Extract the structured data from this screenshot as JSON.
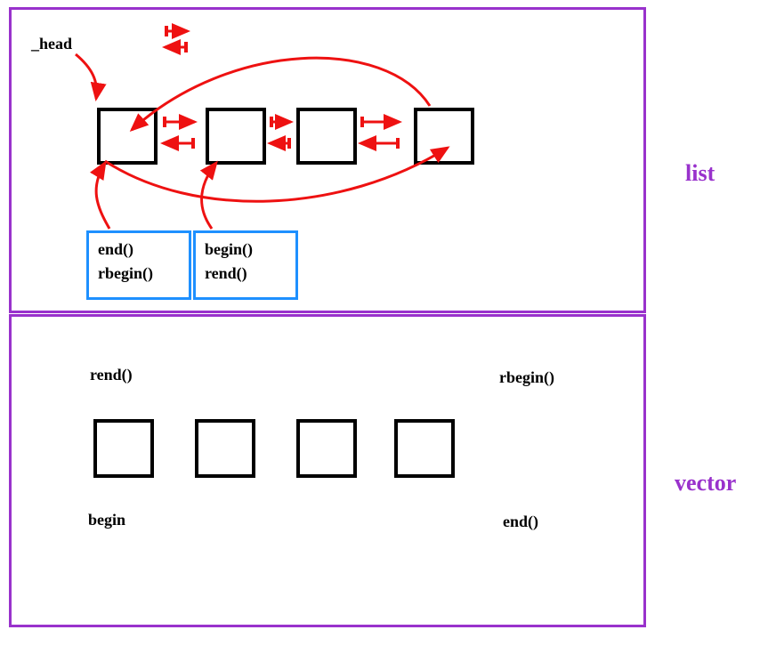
{
  "labels": {
    "list": "list",
    "vector": "vector"
  },
  "top": {
    "head": "_head",
    "end": "end()",
    "rbegin": "rbegin()",
    "begin": "begin()",
    "rend": "rend()"
  },
  "bottom": {
    "rend": "rend()",
    "rbegin": "rbegin()",
    "begin": "begin",
    "end": "end()"
  },
  "chart_data": {
    "type": "table",
    "title": "C++ container iterator/layout comparison: list vs vector",
    "containers": [
      {
        "name": "list",
        "nodes": 4,
        "sentinel": "_head",
        "links": "bidirectional",
        "circular": true,
        "iterators": {
          "end()": "points at _head sentinel (first drawn box)",
          "rbegin()": "points at _head sentinel (first drawn box)",
          "begin()": "points at first real node (second drawn box)",
          "rend()": "points at first real node (second drawn box)"
        }
      },
      {
        "name": "vector",
        "nodes": 4,
        "iterators": {
          "begin": "before first element",
          "rend()": "before first element",
          "end()": "past last element",
          "rbegin()": "past last element"
        }
      }
    ]
  }
}
